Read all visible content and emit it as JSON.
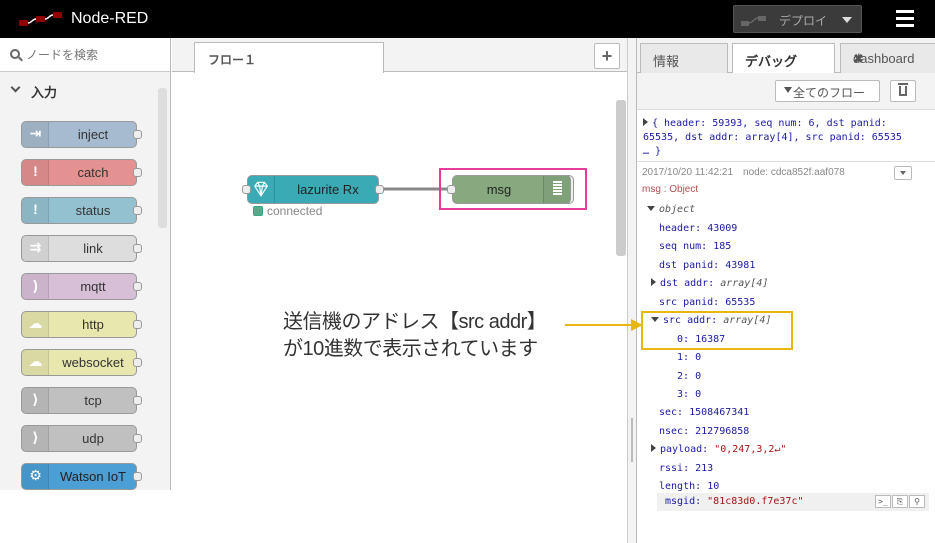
{
  "header": {
    "title": "Node-RED",
    "deploy_label": "デプロイ"
  },
  "palette": {
    "search_placeholder": "ノードを検索",
    "category_label": "入力",
    "nodes": [
      {
        "label": "inject",
        "color": "#a6bbcf",
        "icon": "inject-icon"
      },
      {
        "label": "catch",
        "color": "#e49191",
        "icon": "catch-icon"
      },
      {
        "label": "status",
        "color": "#94c1d0",
        "icon": "status-icon"
      },
      {
        "label": "link",
        "color": "#dddddd",
        "icon": "link-icon"
      },
      {
        "label": "mqtt",
        "color": "#d8bfd8",
        "icon": "mqtt-icon"
      },
      {
        "label": "http",
        "color": "#e7e7ae",
        "icon": "http-icon"
      },
      {
        "label": "websocket",
        "color": "#e7e7ae",
        "icon": "websocket-icon"
      },
      {
        "label": "tcp",
        "color": "#c0c0c0",
        "icon": "tcp-icon"
      },
      {
        "label": "udp",
        "color": "#c0c0c0",
        "icon": "udp-icon"
      },
      {
        "label": "Watson IoT",
        "color": "#4b9fd5",
        "icon": "watson-iot-icon"
      }
    ]
  },
  "workspace": {
    "tab_label": "フロー１",
    "nodes": {
      "lazurite": {
        "label": "lazurite Rx",
        "status": "connected"
      },
      "msg": {
        "label": "msg"
      }
    },
    "annotation_line1": "送信機のアドレス【src addr】",
    "annotation_line2": "が10進数で表示されています"
  },
  "sidebar": {
    "tabs": {
      "info": "情報",
      "debug": "デバッグ",
      "dashboard": "dashboard"
    },
    "filter_label": "全てのフロー",
    "prev_message_line1": "{ header: 59393, seq num: 6, dst panid:",
    "prev_message_line2": "65535, dst addr: array[4], src panid: 65535",
    "prev_message_line3": "… }",
    "timestamp": "2017/10/20 11:42:21",
    "node_ref": "node: cdca852f.aaf078",
    "msg_type": "msg : Object",
    "tree": {
      "object": "object",
      "header_key": "header:",
      "header_val": "43009",
      "seq_key": "seq num:",
      "seq_val": "185",
      "dstpanid_key": "dst panid:",
      "dstpanid_val": "43981",
      "dstaddr_key": "dst addr:",
      "dstaddr_val": "array[4]",
      "srcpanid_key": "src panid:",
      "srcpanid_val": "65535",
      "srcaddr_key": "src addr:",
      "srcaddr_val": "array[4]",
      "i0_key": "0:",
      "i0_val": "16387",
      "i1_key": "1:",
      "i1_val": "0",
      "i2_key": "2:",
      "i2_val": "0",
      "i3_key": "3:",
      "i3_val": "0",
      "sec_key": "sec:",
      "sec_val": "1508467341",
      "nsec_key": "nsec:",
      "nsec_val": "212796858",
      "payload_key": "payload:",
      "payload_val": "\"0,247,3,2↵\"",
      "rssi_key": "rssi:",
      "rssi_val": "213",
      "length_key": "length:",
      "length_val": "10",
      "msgid_key": "msgid:",
      "msgid_val": "\"81c83d0.f7e37c\""
    }
  },
  "colors": {
    "lazurite_node": "#3aabb5",
    "debug_node": "#87a980",
    "highlight_pink": "#e63b9b",
    "highlight_yellow": "#e8b70f"
  }
}
